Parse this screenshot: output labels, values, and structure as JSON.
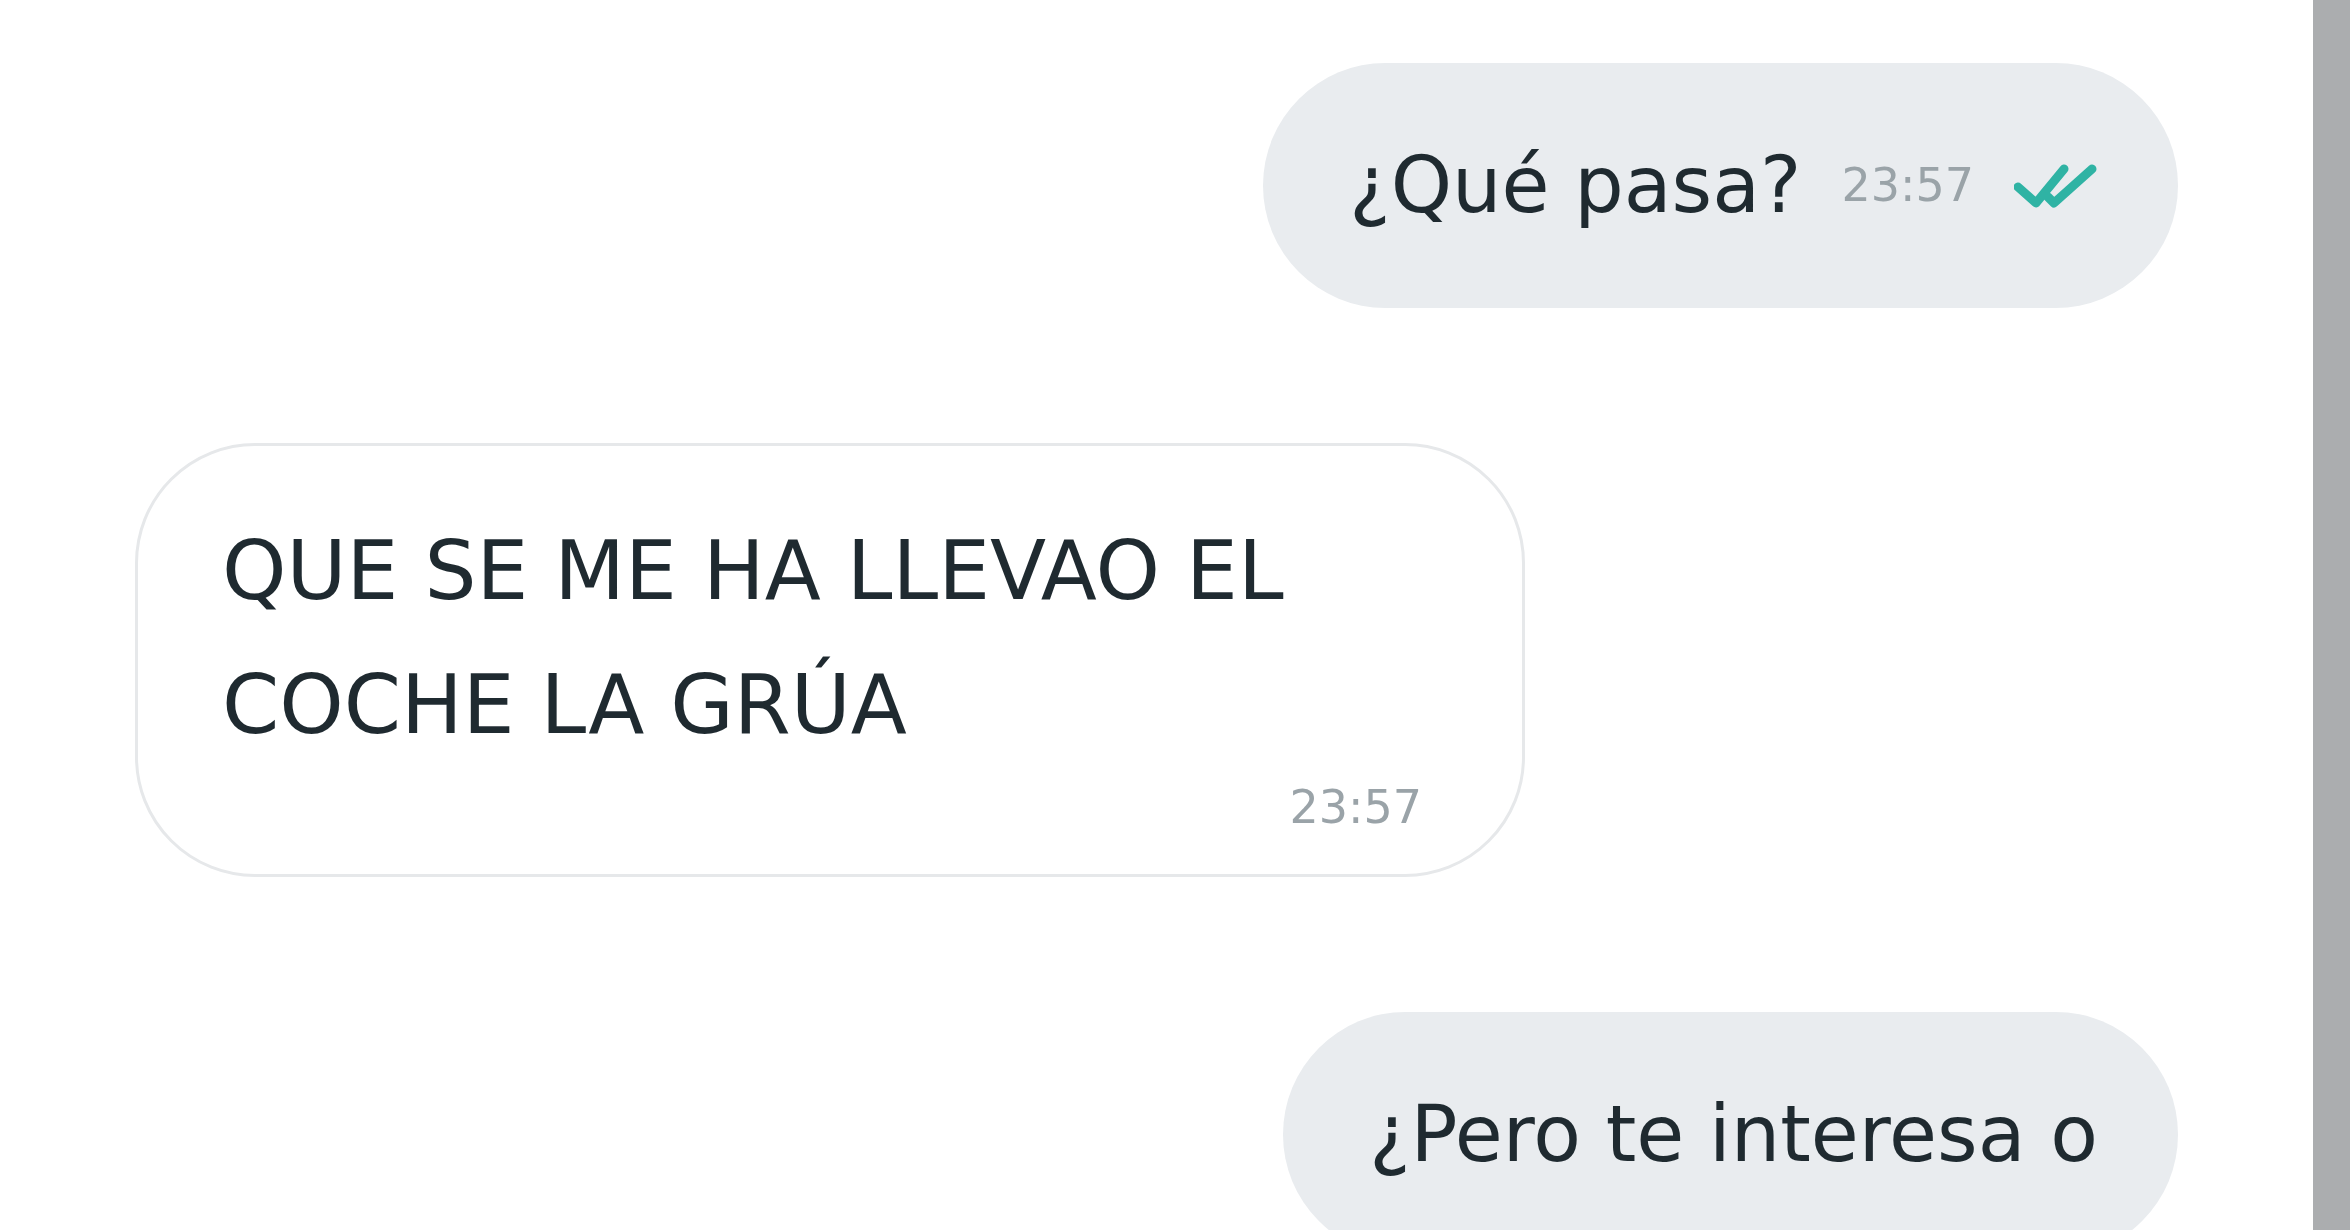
{
  "messages": [
    {
      "kind": "sent",
      "text": "¿Qué pasa?",
      "time": "23:57",
      "read": true
    },
    {
      "kind": "received",
      "text": "QUE SE ME HA LLEVAO EL COCHE LA GRÚA",
      "time": "23:57"
    },
    {
      "kind": "sent",
      "text": "¿Pero te interesa o"
    }
  ]
}
